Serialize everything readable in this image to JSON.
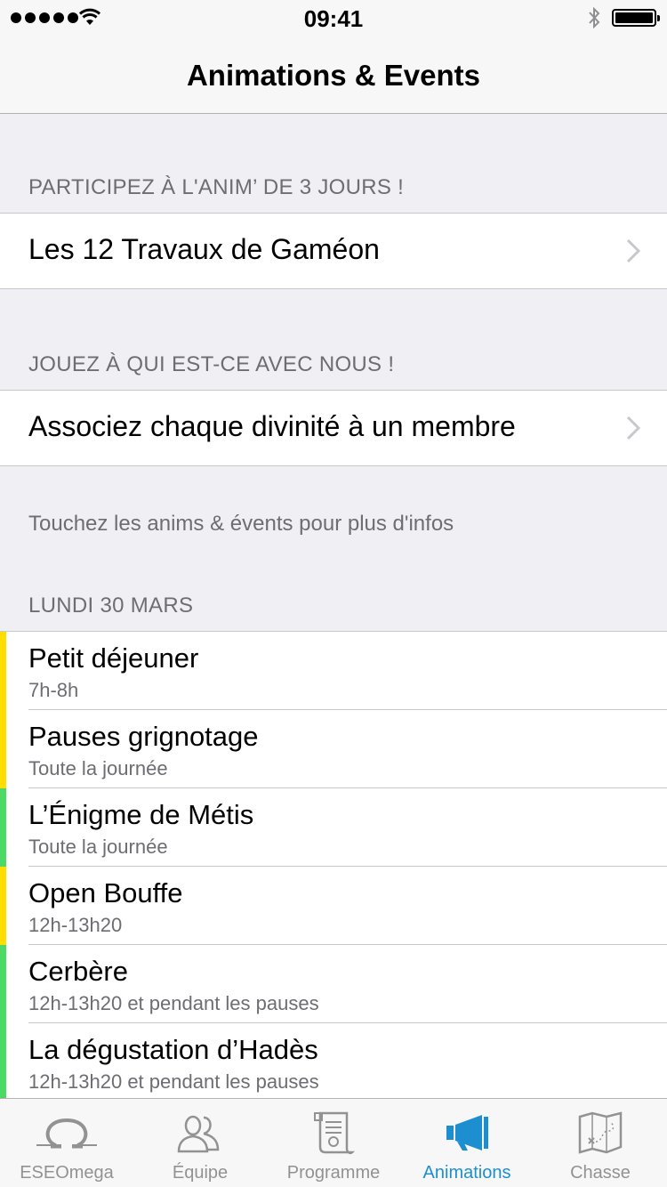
{
  "status_bar": {
    "time": "09:41"
  },
  "nav": {
    "title": "Animations & Events"
  },
  "sections": [
    {
      "header": "PARTICIPEZ À L'ANIM’ DE 3 JOURS !",
      "item": "Les 12 Travaux de Gaméon"
    },
    {
      "header": "JOUEZ À QUI EST-CE AVEC NOUS !",
      "item": "Associez chaque divinité à un membre"
    }
  ],
  "footer_note": "Touchez les anims & évents pour plus d'infos",
  "day_header": "LUNDI 30 MARS",
  "events": [
    {
      "title": "Petit déjeuner",
      "time": "7h-8h",
      "color": "#ffdd00"
    },
    {
      "title": "Pauses grignotage",
      "time": "Toute la journée",
      "color": "#ffdd00"
    },
    {
      "title": "L’Énigme de Métis",
      "time": "Toute la journée",
      "color": "#4cd964"
    },
    {
      "title": "Open Bouffe",
      "time": "12h-13h20",
      "color": "#ffdd00"
    },
    {
      "title": "Cerbère",
      "time": "12h-13h20 et pendant les pauses",
      "color": "#4cd964"
    },
    {
      "title": "La dégustation d’Hadès",
      "time": "12h-13h20 et pendant les pauses",
      "color": "#4cd964"
    }
  ],
  "tabs": [
    {
      "label": "ESEOmega",
      "icon": "omega-icon",
      "active": false
    },
    {
      "label": "Équipe",
      "icon": "team-icon",
      "active": false
    },
    {
      "label": "Programme",
      "icon": "scroll-icon",
      "active": false
    },
    {
      "label": "Animations",
      "icon": "megaphone-icon",
      "active": true
    },
    {
      "label": "Chasse",
      "icon": "treasure-map-icon",
      "active": false
    }
  ],
  "colors": {
    "accent": "#1d8fd1",
    "inactive_tab": "#929292",
    "event_yellow": "#ffdd00",
    "event_green": "#4cd964"
  }
}
